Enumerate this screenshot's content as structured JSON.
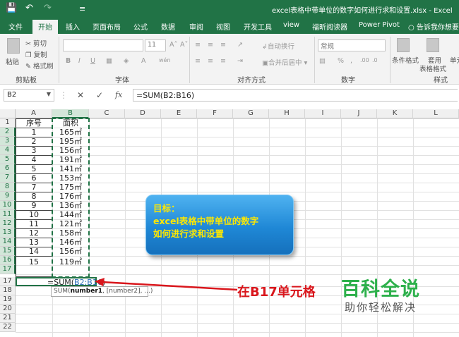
{
  "window": {
    "title": "excel表格中带单位的数字如何进行求和设置.xlsx  -  Excel",
    "quick_access": {
      "save": "💾",
      "undo": "↶",
      "redo": "↷",
      "customize": "≡"
    }
  },
  "menu": {
    "tabs": [
      "文件",
      "开始",
      "插入",
      "页面布局",
      "公式",
      "数据",
      "审阅",
      "视图",
      "开发工具",
      "view",
      "福昕阅读器",
      "Power Pivot"
    ],
    "active_tab": "开始",
    "tell_me": "告诉我你想要做"
  },
  "ribbon": {
    "clipboard": {
      "paste": "粘贴",
      "cut": "剪切",
      "copy": "复制",
      "format_painter": "格式刷",
      "label": "剪贴板"
    },
    "font": {
      "size": "11",
      "bold": "B",
      "italic": "I",
      "underline": "U",
      "grow": "A˄",
      "shrink": "A˅",
      "color_a": "A",
      "phonetic": "wén",
      "label": "字体"
    },
    "alignment": {
      "wrap": "自动换行",
      "merge": "合并后居中",
      "label": "对齐方式"
    },
    "number": {
      "format": "常规",
      "percent": "%",
      "comma": ",",
      "label": "数字"
    },
    "styles": {
      "conditional": "条件格式",
      "table": "套用",
      "table2": "表格格式",
      "cell": "单元",
      "label": "样式"
    }
  },
  "formula_bar": {
    "name_box": "B2",
    "cancel": "✕",
    "enter": "✓",
    "fx": "fx",
    "formula": "=SUM(B2:B16)"
  },
  "sheet": {
    "columns": [
      "A",
      "B",
      "C",
      "D",
      "E",
      "F",
      "G",
      "H",
      "I",
      "J",
      "K",
      "L"
    ],
    "rows": [
      "1",
      "2",
      "3",
      "4",
      "5",
      "6",
      "7",
      "8",
      "9",
      "10",
      "11",
      "12",
      "13",
      "14",
      "15",
      "16",
      "17",
      "18",
      "19",
      "20",
      "21",
      "22"
    ],
    "header": {
      "a": "序号",
      "b": "面积"
    },
    "data": [
      {
        "n": "1",
        "area": "165㎡"
      },
      {
        "n": "2",
        "area": "195㎡"
      },
      {
        "n": "3",
        "area": "156㎡"
      },
      {
        "n": "4",
        "area": "191㎡"
      },
      {
        "n": "5",
        "area": "141㎡"
      },
      {
        "n": "6",
        "area": "153㎡"
      },
      {
        "n": "7",
        "area": "175㎡"
      },
      {
        "n": "8",
        "area": "176㎡"
      },
      {
        "n": "9",
        "area": "136㎡"
      },
      {
        "n": "10",
        "area": "144㎡"
      },
      {
        "n": "11",
        "area": "121㎡"
      },
      {
        "n": "12",
        "area": "158㎡"
      },
      {
        "n": "13",
        "area": "146㎡"
      },
      {
        "n": "14",
        "area": "156㎡"
      },
      {
        "n": "15",
        "area": "119㎡"
      }
    ],
    "editing_cell": {
      "prefix": "=SUM(",
      "ref": "B2:B16",
      "suffix": ")"
    },
    "tooltip": {
      "fn": "SUM(",
      "arg1": "number1",
      "rest": ", [number2], ...)"
    }
  },
  "callout": {
    "line1": "目标：",
    "line2": "excel表格中带单位的数字",
    "line3": "如何进行求和设置"
  },
  "annotation": "在B17单元格",
  "watermark": {
    "line1": "百科全说",
    "line2": "助你轻松解决"
  },
  "colors": {
    "excel_green": "#217346",
    "callout_text": "#ffe800",
    "arrow_red": "#d9161c",
    "brand_green": "#2db04b"
  }
}
